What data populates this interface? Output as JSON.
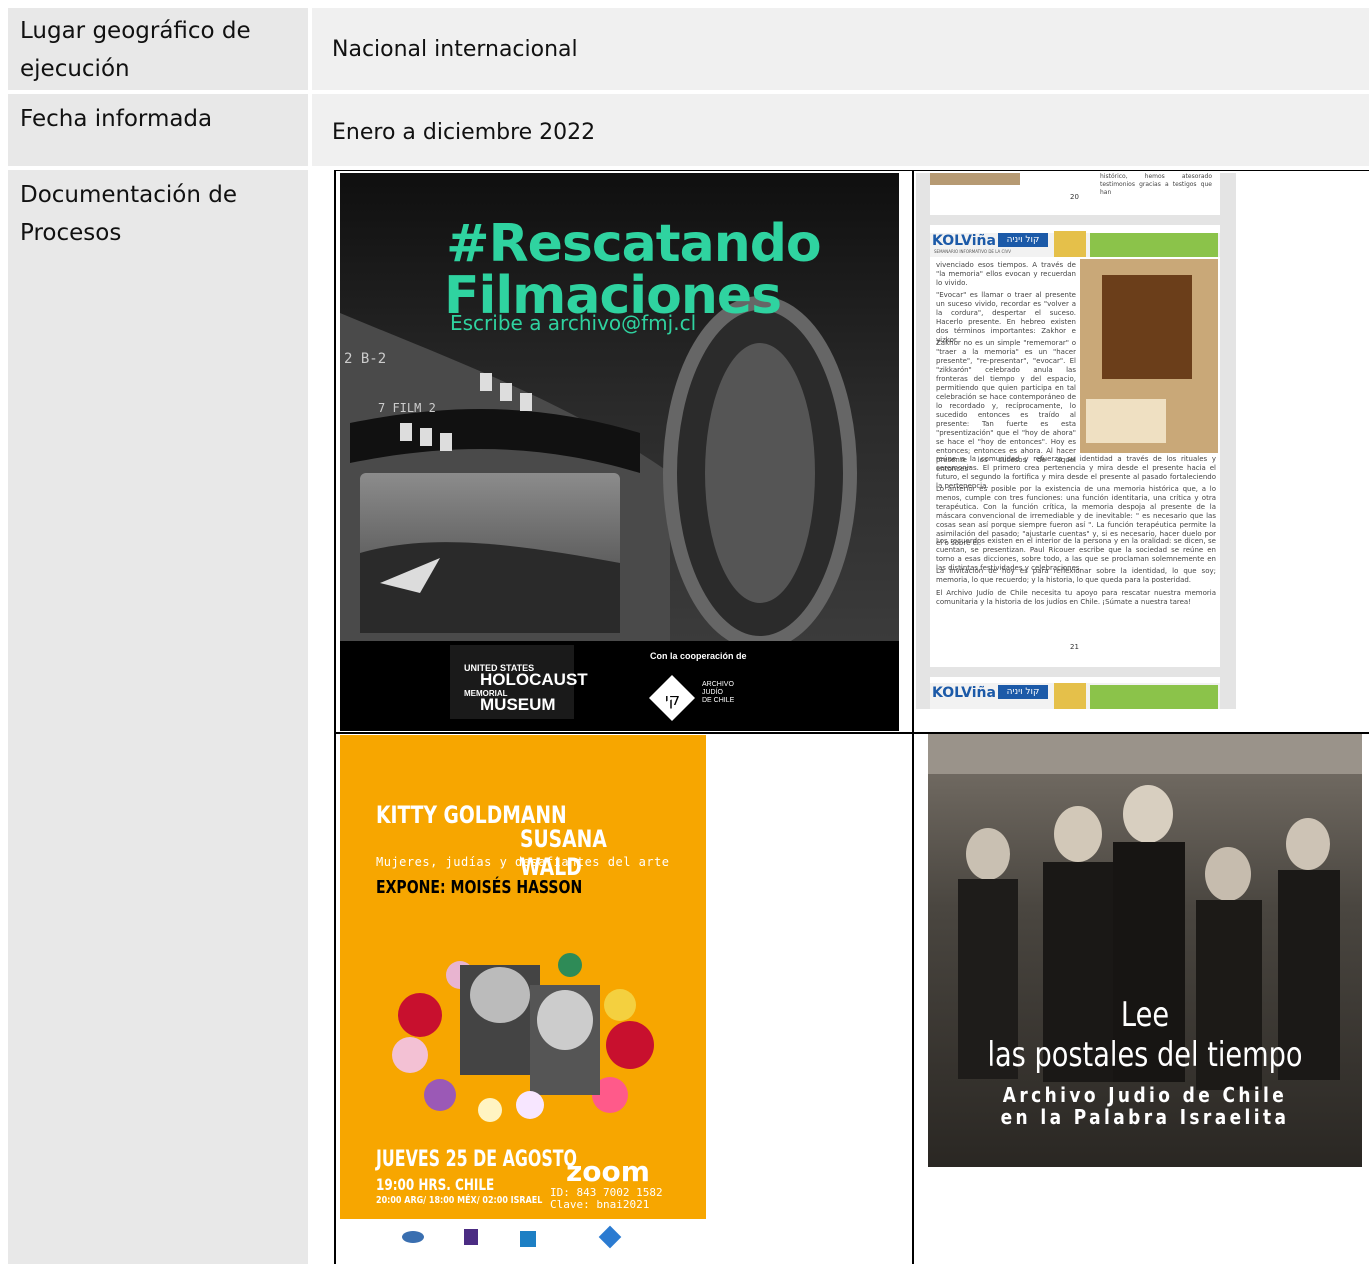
{
  "table": {
    "rows": [
      {
        "label": "Lugar geográfico de ejecución",
        "value": "Nacional internacional"
      },
      {
        "label": "Fecha informada",
        "value": "Enero a diciembre 2022"
      },
      {
        "label": "Documentación de Procesos",
        "value": ""
      }
    ]
  },
  "images": {
    "rescatando": {
      "title_line1": "#Rescatando",
      "title_line2": "Filmaciones",
      "email_line": "Escribe a archivo@fmj.cl",
      "film_label1": "2   B-2",
      "film_label2": "7      FILM 2",
      "museum_line1": "UNITED STATES",
      "museum_line2": "HOLOCAUST",
      "museum_line3": "MEMORIAL",
      "museum_line4": "MUSEUM",
      "coop": "Con la cooperación de",
      "archivo1": "ARCHIVO",
      "archivo2": "JUDÍO",
      "archivo3": "DE CHILE"
    },
    "kolvina": {
      "brand": "KOLViña",
      "hebrew": "קול ויניה",
      "subtitle": "SEMANARIO INFORMATIVO DE LA CIVV",
      "page_top_text": "histórico, hemos atesorado testimonios gracias a testigos que han",
      "page_num1": "20",
      "page_num2": "21",
      "para1": "vivenciado esos tiempos. A través de \"la memoria\" ellos evocan y recuerdan lo vivido.",
      "para2": "\"Evocar\" es llamar o traer al presente un suceso vivido, recordar es \"volver a la cordura\", despertar el suceso. Hacerlo presente. En hebreo existen dos términos importantes: Zakhor e yizkor.",
      "para3": "Zakhor no es un simple \"rememorar\" o \"traer a la memoria\" es un \"hacer presente\", \"re-presentar\", \"evocar\". El \"zikkarón\" celebrado anula las fronteras del tiempo y del espacio, permitiendo que quien participa en tal celebración se hace contemporáneo de lo recordado y, recíprocamente, lo sucedido entonces es traído al presente: Tan fuerte es esta \"presentización\" que el \"hoy de ahora\" se hace el \"hoy de entonces\". Hoy es entonces; entonces es ahora. Al hacer presente los sucesos de aquel entonces\"",
      "para4": "reúne a la comunidad y refuerza su identidad a través de los rituales y ceremonias. El primero crea pertenencia y mira desde el presente hacia el futuro, el segundo la fortifica y mira desde el presente al pasado fortaleciendo la pertenencia.",
      "para5": "Lo anterior es posible por la existencia de una memoria histórica que, a lo menos, cumple con tres funciones: una función identitaria, una crítica y otra terapéutica. Con la función crítica, la memoria despoja al presente de la máscara convencional de irremediable y de inevitable: \" es necesario que las cosas sean así porque siempre fueron así \". La función terapéutica permite la asimilación del pasado; \"ajustarle cuentas\" y, si es necesario, hacer duelo por él o sobre él.",
      "para6": "Los recuerdos existen en el interior de la persona y en la oralidad: se dicen, se cuentan, se presentizan. Paul Ricouer escribe que la sociedad se reúne en torno a esas dicciones, sobre todo, a las que se proclaman solemnemente en las distintas festividades y celebraciones.",
      "para7": "La invitación de hoy es para reflexionar sobre la identidad, lo que soy; memoria, lo que recuerdo; y la historia, lo que queda para la posteridad.",
      "para8": "El Archivo Judío de Chile necesita tu apoyo para rescatar nuestra memoria comunitaria y la historia de los judíos en Chile. ¡Súmate a nuestra tarea!"
    },
    "kitty": {
      "name1": "KITTY GOLDMANN",
      "name2": "SUSANA WALD",
      "subtitle": "Mujeres, judías y desafiantes del arte",
      "expone": "EXPONE: MOISÉS HASSON",
      "date": "JUEVES 25 DE AGOSTO",
      "time": "19:00 HRS. CHILE",
      "times_other": "20:00 ARG/ 18:00 MÉX/ 02:00 ISRAEL",
      "zoom": "zoom",
      "zoom_id": "ID: 843 7002 1582",
      "zoom_key": "Clave: bnai2021"
    },
    "postales": {
      "line1": "Lee",
      "line2": "las postales del tiempo",
      "line3": "Archivo Judio de Chile",
      "line4": "en la Palabra Israelita"
    }
  },
  "colors": {
    "label_bg": "#e8e8e8",
    "value_bg": "#f0f0f0",
    "rescatando_green": "#2fd3a0",
    "kitty_orange": "#f7a600",
    "kolvina_blue": "#1c5aa8",
    "kolvina_green": "#8bc34a"
  }
}
